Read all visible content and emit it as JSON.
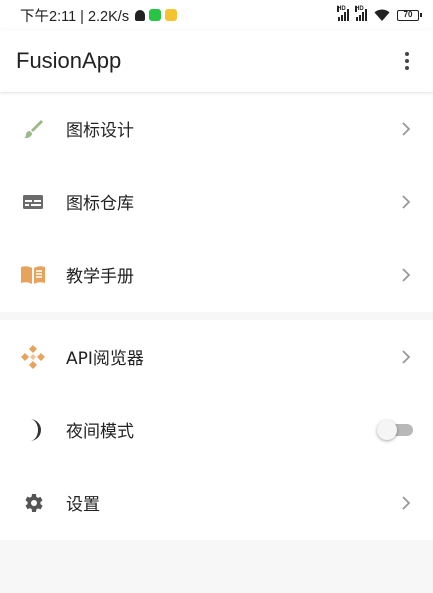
{
  "status_bar": {
    "text": "下午2:11 | 2.2K/s",
    "network_1": "HD",
    "network_2": "HD",
    "battery": "70"
  },
  "toolbar": {
    "title": "FusionApp"
  },
  "menu_group_1": [
    {
      "label": "图标设计",
      "icon": "brush-icon",
      "color": "#9bb98a"
    },
    {
      "label": "图标仓库",
      "icon": "card-icon",
      "color": "#6b6b6b"
    },
    {
      "label": "教学手册",
      "icon": "book-icon",
      "color": "#e7a35c"
    }
  ],
  "menu_group_2": [
    {
      "label": "API阅览器",
      "icon": "diamond-icon",
      "color": "#e7a35c"
    },
    {
      "label": "夜间模式",
      "icon": "moon-icon",
      "color": "#333333",
      "toggle": false
    },
    {
      "label": "设置",
      "icon": "gear-icon",
      "color": "#555555"
    }
  ]
}
